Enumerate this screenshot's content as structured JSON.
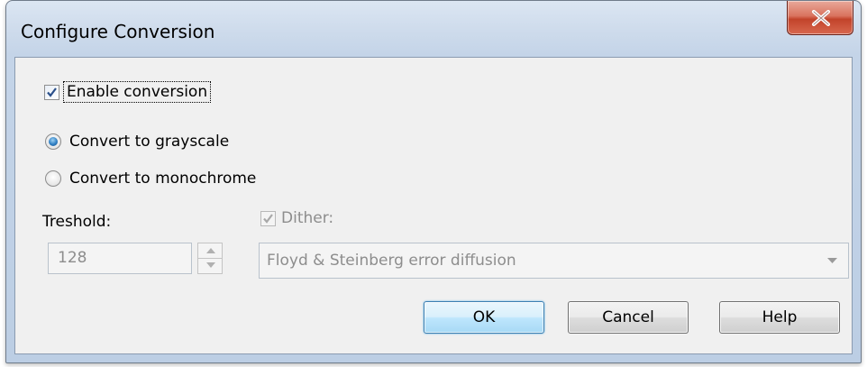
{
  "window": {
    "title": "Configure Conversion"
  },
  "options": {
    "enable_conversion": {
      "label": "Enable conversion",
      "checked": true
    },
    "grayscale": {
      "label": "Convert to grayscale",
      "selected": true
    },
    "monochrome": {
      "label": "Convert to monochrome",
      "selected": false
    }
  },
  "threshold": {
    "label": "Treshold:",
    "value": "128"
  },
  "dither": {
    "label": "Dither:",
    "checked": true,
    "selected_method": "Floyd & Steinberg error diffusion"
  },
  "buttons": {
    "ok": "OK",
    "cancel": "Cancel",
    "help": "Help"
  },
  "colors": {
    "close_button": "#c2432a",
    "radio_selected": "#2f7fc3",
    "disabled_text": "#8d8d8d"
  }
}
